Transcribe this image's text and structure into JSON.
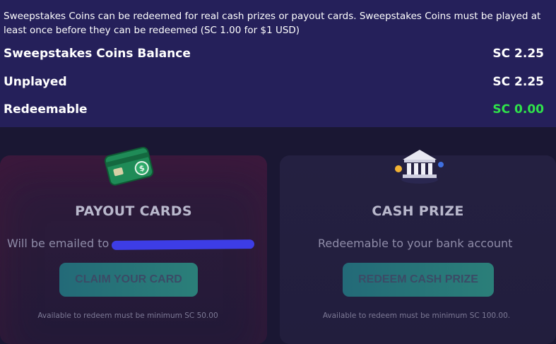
{
  "info": {
    "description": "Sweepstakes Coins can be redeemed for real cash prizes or payout cards. Sweepstakes Coins must be played at least once before they can be redeemed (SC 1.00 for $1 USD)"
  },
  "balances": [
    {
      "label": "Sweepstakes Coins Balance",
      "value": "SC 2.25"
    },
    {
      "label": "Unplayed",
      "value": "SC 2.25"
    },
    {
      "label": "Redeemable",
      "value": "SC 0.00"
    }
  ],
  "payout": {
    "title": "PAYOUT CARDS",
    "description": "Will be emailed to",
    "button": "CLAIM YOUR CARD",
    "note": "Available to redeem must be minimum SC 50.00",
    "icon": "credit-card-icon"
  },
  "cash": {
    "title": "CASH PRIZE",
    "description": "Redeemable to your bank account",
    "button": "REDEEM CASH PRIZE",
    "note": "Available to redeem must be minimum SC 100.00.",
    "icon": "bank-icon"
  },
  "colors": {
    "panel": "#25205a",
    "accent_green": "#2fe34a",
    "button_teal": "#236a78"
  }
}
